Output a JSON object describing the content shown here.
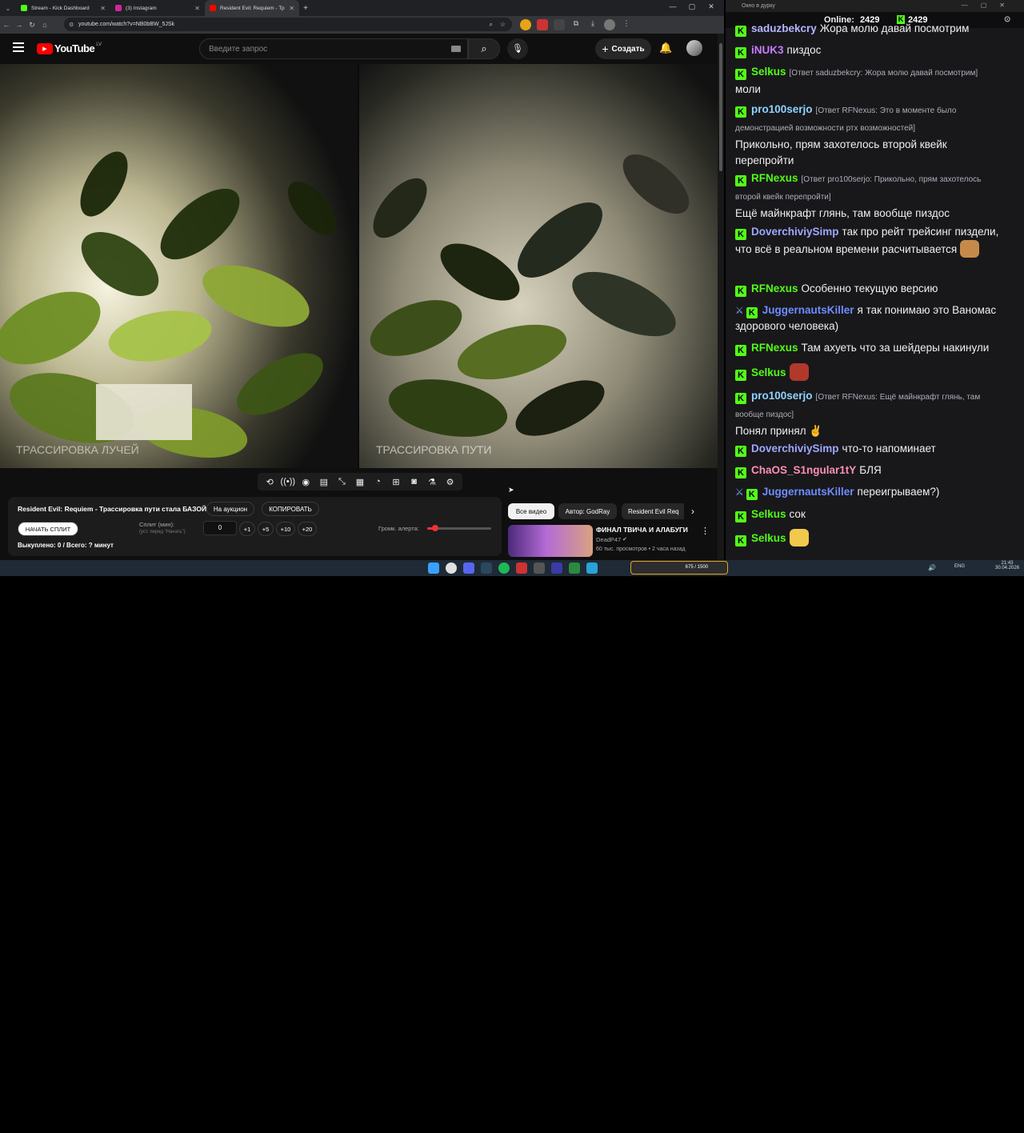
{
  "browser": {
    "tabs": [
      {
        "label": "Stream - Kick Dashboard",
        "color": "#53fc18"
      },
      {
        "label": "(3) Instagram",
        "color": "#d6249f"
      },
      {
        "label": "Resident Evil: Requiem - Тр",
        "color": "#ff0000"
      }
    ],
    "url": "youtube.com/watch?v=NB0bBW_5JSk"
  },
  "youtube": {
    "logo": "YouTube",
    "region": "LV",
    "search_placeholder": "Введите запрос",
    "create_label": "Создать"
  },
  "video": {
    "left_caption": "ТРАССИРОВКА ЛУЧЕЙ",
    "right_caption": "ТРАССИРОВКА ПУТИ"
  },
  "panel": {
    "title": "Resident Evil: Requiem - Трассировка пути стала БАЗОЙ!",
    "auction_label": "На аукцион",
    "copy_label": "КОПИРОВАТЬ",
    "start_split_label": "НАЧАТЬ СПЛИТ",
    "split_label": "Сплит (мин):",
    "split_hint": "(уст. перед \"Начать\")",
    "split_value": "0",
    "increments": [
      "+1",
      "+5",
      "+10",
      "+20"
    ],
    "alert_volume_label": "Громк. алерта:",
    "alert_volume_level": 0.12,
    "bought_label": "Выкуплено: 0 / Всего: ? минут"
  },
  "recs": {
    "chips": [
      "Все видео",
      "Автор: GodRay",
      "Resident Evil Req"
    ],
    "video_title": "ФИНАЛ ТВИЧА И АЛАБУГИ",
    "channel": "DeadP47",
    "meta": "60 тыс. просмотров • 2 часа назад"
  },
  "chat": {
    "window_title": "Окно в дурку",
    "online_label": "Online:",
    "online_count": "2429",
    "viewer_count": "2429",
    "messages": [
      {
        "user": "saduzbekcry",
        "color": "#b4b4ff",
        "text": "Жора молю давай посмотрим"
      },
      {
        "user": "iNUK3",
        "color": "#c77dff",
        "text": "пиздос"
      },
      {
        "user": "Selkus",
        "color": "#53fc18",
        "reply": "[Ответ saduzbekcry: Жора молю давай посмотрим]",
        "text": "моли"
      },
      {
        "user": "pro100serjo",
        "color": "#8fd3ff",
        "reply": "[Ответ RFNexus: Это в моменте было демонстрацией возможности ртх возможностей]",
        "text": "Прикольно, прям захотелось второй квейк перепройти"
      },
      {
        "user": "RFNexus",
        "color": "#53fc18",
        "reply": "[Ответ pro100serjo: Прикольно, прям захотелось второй квейк перепройти]",
        "text": "Ещё майнкрафт глянь, там вообще пиздос"
      },
      {
        "user": "DoverchiviySimp",
        "color": "#9ea7ff",
        "text": "так про рейт трейсинг пиздели, что всё в реальном времени расчитывается"
      },
      {
        "user": "RFNexus",
        "color": "#53fc18",
        "text": "Особенно текущую версию"
      },
      {
        "user": "JuggernautsKiller",
        "color": "#6e8cff",
        "text": "я так понимаю это Ваномас здорового человека)"
      },
      {
        "user": "RFNexus",
        "color": "#53fc18",
        "text": "Там ахуеть что за шейдеры накинули"
      },
      {
        "user": "Selkus",
        "color": "#53fc18",
        "text": ""
      },
      {
        "user": "pro100serjo",
        "color": "#8fd3ff",
        "reply": "[Ответ RFNexus: Ещё майнкрафт глянь, там вообще пиздос]",
        "text": "Понял принял"
      },
      {
        "user": "DoverchiviySimp",
        "color": "#9ea7ff",
        "text": "что-то напоминает"
      },
      {
        "user": "ChaOS_S1ngular1tY",
        "color": "#ff8fb1",
        "text": "БЛЯ"
      },
      {
        "user": "JuggernautsKiller",
        "color": "#6e8cff",
        "text": "переигрываем?)"
      },
      {
        "user": "Selkus",
        "color": "#53fc18",
        "text": "сок"
      },
      {
        "user": "Selkus",
        "color": "#53fc18",
        "text": ""
      }
    ]
  },
  "taskbar": {
    "progress_text": "675 / 1500",
    "lang": "ENG",
    "time": "21:43",
    "date": "30.04.2026"
  }
}
